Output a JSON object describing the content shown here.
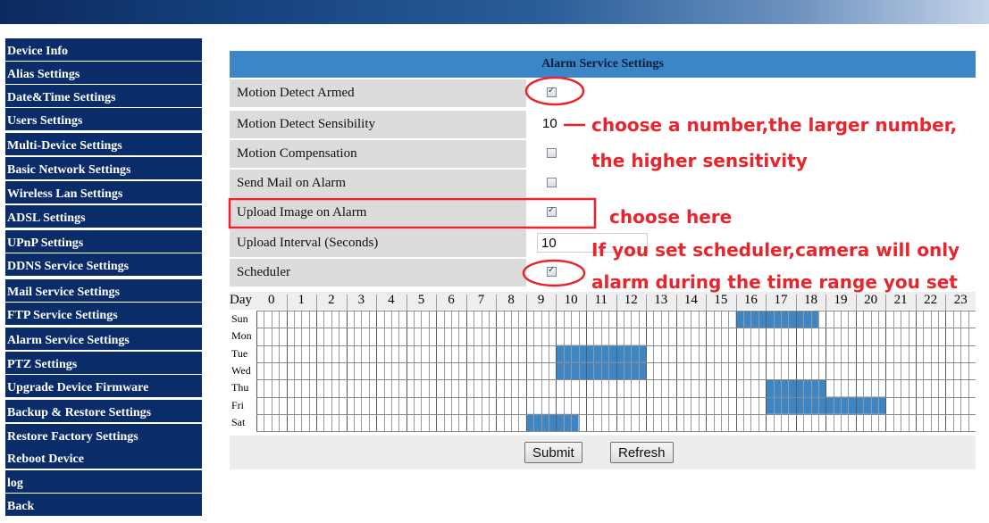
{
  "sidebar": {
    "items": [
      "Device Info",
      "Alias Settings",
      "Date&Time Settings",
      "Users Settings",
      "Multi-Device Settings",
      "Basic Network Settings",
      "Wireless Lan Settings",
      "ADSL Settings",
      "UPnP Settings",
      "DDNS Service Settings",
      "Mail Service Settings",
      "FTP Service Settings",
      "Alarm Service Settings",
      "PTZ Settings",
      "Upgrade Device Firmware",
      "Backup & Restore Settings",
      "Restore Factory Settings",
      "Reboot Device",
      "log",
      "Back"
    ]
  },
  "panel": {
    "title": "Alarm Service Settings",
    "rows": [
      {
        "label": "Motion Detect Armed",
        "type": "checkbox",
        "checked": true
      },
      {
        "label": "Motion Detect Sensibility",
        "type": "select",
        "value": "10"
      },
      {
        "label": "Motion Compensation",
        "type": "checkbox",
        "checked": false
      },
      {
        "label": "Send Mail on Alarm",
        "type": "checkbox",
        "checked": false
      },
      {
        "label": "Upload Image on Alarm",
        "type": "checkbox",
        "checked": true
      },
      {
        "label": "Upload Interval (Seconds)",
        "type": "text",
        "value": "10"
      },
      {
        "label": "Scheduler",
        "type": "checkbox",
        "checked": true
      }
    ]
  },
  "scheduler": {
    "day_header": "Day",
    "hours": [
      "0",
      "1",
      "2",
      "3",
      "4",
      "5",
      "6",
      "7",
      "8",
      "9",
      "10",
      "11",
      "12",
      "13",
      "14",
      "15",
      "16",
      "17",
      "18",
      "19",
      "20",
      "21",
      "22",
      "23"
    ],
    "days": [
      "Sun",
      "Mon",
      "Tue",
      "Wed",
      "Thu",
      "Fri",
      "Sat"
    ],
    "selected_ranges": [
      {
        "day": "Sun",
        "from_slot": 64,
        "to_slot": 75
      },
      {
        "day": "Tue",
        "from_slot": 40,
        "to_slot": 52
      },
      {
        "day": "Wed",
        "from_slot": 40,
        "to_slot": 52
      },
      {
        "day": "Thu",
        "from_slot": 68,
        "to_slot": 76
      },
      {
        "day": "Fri",
        "from_slot": 68,
        "to_slot": 84
      },
      {
        "day": "Sat",
        "from_slot": 36,
        "to_slot": 43
      }
    ],
    "colors": {
      "selected": "#3d86c6",
      "cell_bg": "#ffffff",
      "grid": "#9a9a9a"
    }
  },
  "buttons": {
    "submit": "Submit",
    "refresh": "Refresh"
  },
  "annotations": {
    "sensibility": "choose a number,the larger number,",
    "sensibility2": "the higher sensitivity",
    "upload": "choose here",
    "scheduler1": "If you set scheduler,camera will only",
    "scheduler2": "alarm during the time range you set"
  },
  "colors": {
    "sidebar_bg": "#0a2d6a",
    "title_bar": "#3c86c8",
    "annotation": "#e8252d"
  }
}
